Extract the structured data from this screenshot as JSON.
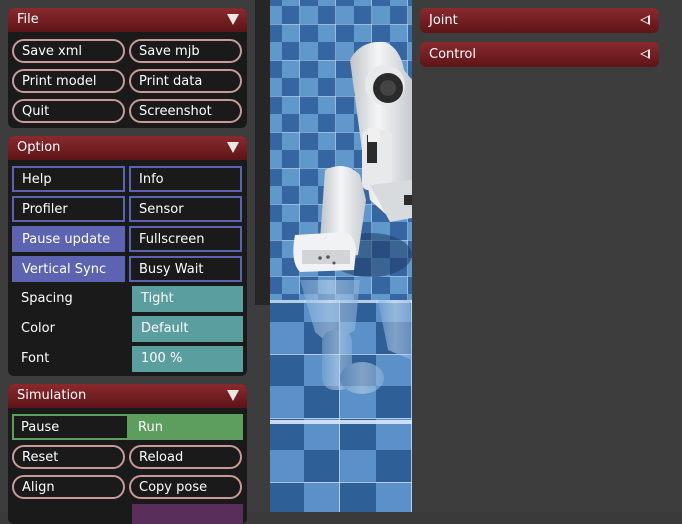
{
  "file": {
    "title": "File",
    "buttons": [
      "Save xml",
      "Save mjb",
      "Print model",
      "Print data",
      "Quit",
      "Screenshot"
    ]
  },
  "option": {
    "title": "Option",
    "checkboxes": [
      {
        "label": "Help",
        "checked": false
      },
      {
        "label": "Info",
        "checked": false
      },
      {
        "label": "Profiler",
        "checked": false
      },
      {
        "label": "Sensor",
        "checked": false
      },
      {
        "label": "Pause update",
        "checked": true
      },
      {
        "label": "Fullscreen",
        "checked": false
      },
      {
        "label": "Vertical Sync",
        "checked": true
      },
      {
        "label": "Busy Wait",
        "checked": false
      }
    ],
    "spacing": {
      "label": "Spacing",
      "value": "Tight"
    },
    "color": {
      "label": "Color",
      "value": "Default"
    },
    "font": {
      "label": "Font",
      "value": "100 %"
    }
  },
  "simulation": {
    "title": "Simulation",
    "mode": {
      "options": [
        "Pause",
        "Run"
      ],
      "selected": "Run"
    },
    "buttons": [
      "Reset",
      "Reload",
      "Align",
      "Copy pose"
    ]
  },
  "right_panels": [
    {
      "title": "Joint"
    },
    {
      "title": "Control"
    }
  ],
  "colors": {
    "header": "#7a2226",
    "checkbox_on": "#5c63b0",
    "select": "#5b9ea0",
    "radio_on": "#5d9d5d",
    "floor_light": "#5f93c9",
    "floor_dark": "#2f5f97"
  }
}
